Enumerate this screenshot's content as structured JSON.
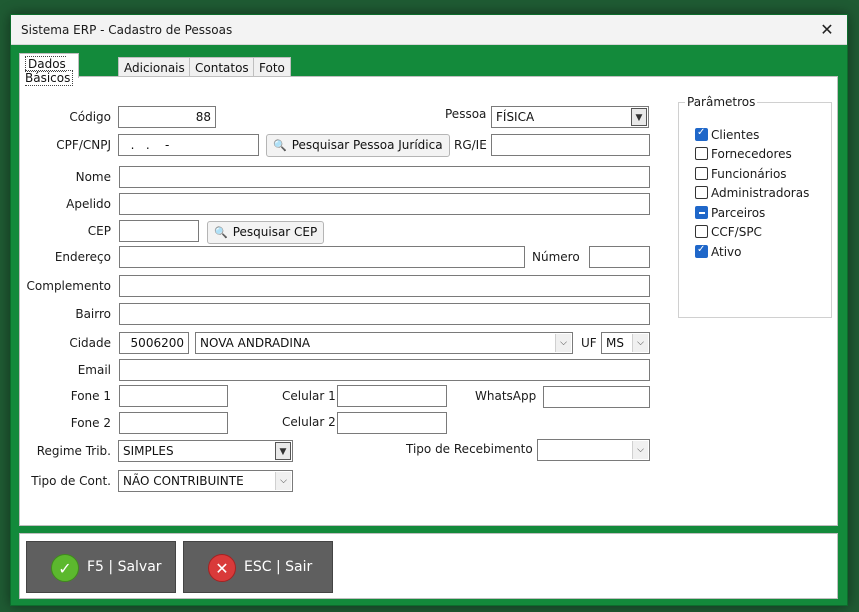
{
  "window": {
    "title": "Sistema ERP - Cadastro de Pessoas",
    "close_glyph": "✕"
  },
  "tabs": [
    {
      "label": "Dados Básicos"
    },
    {
      "label": "Adicionais"
    },
    {
      "label": "Contatos"
    },
    {
      "label": "Foto"
    }
  ],
  "form": {
    "codigo": {
      "label": "Código",
      "value": "88"
    },
    "pessoa": {
      "label": "Pessoa",
      "value": "FÍSICA"
    },
    "cpf_cnpj": {
      "label": "CPF/CNPJ",
      "value": "  .   .    -"
    },
    "btn_pesquisar_pj": "Pesquisar Pessoa Jurídica",
    "rg_ie": {
      "label": "RG/IE",
      "value": ""
    },
    "nome": {
      "label": "Nome",
      "value": ""
    },
    "apelido": {
      "label": "Apelido",
      "value": ""
    },
    "cep": {
      "label": "CEP",
      "value": ""
    },
    "btn_pesquisar_cep": "Pesquisar CEP",
    "endereco": {
      "label": "Endereço",
      "value": ""
    },
    "numero": {
      "label": "Número",
      "value": ""
    },
    "complemento": {
      "label": "Complemento",
      "value": ""
    },
    "bairro": {
      "label": "Bairro",
      "value": ""
    },
    "cidade": {
      "label": "Cidade",
      "code": "5006200",
      "name": "NOVA ANDRADINA"
    },
    "uf": {
      "label": "UF",
      "value": "MS"
    },
    "email": {
      "label": "Email",
      "value": ""
    },
    "fone1": {
      "label": "Fone 1",
      "value": ""
    },
    "celular1": {
      "label": "Celular 1",
      "value": ""
    },
    "whatsapp": {
      "label": "WhatsApp",
      "value": ""
    },
    "fone2": {
      "label": "Fone 2",
      "value": ""
    },
    "celular2": {
      "label": "Celular 2",
      "value": ""
    },
    "regime_trib": {
      "label": "Regime Trib.",
      "value": "SIMPLES"
    },
    "tipo_recebimento": {
      "label": "Tipo de Recebimento",
      "value": ""
    },
    "tipo_cont": {
      "label": "Tipo de Cont.",
      "value": "NÃO CONTRIBUINTE"
    }
  },
  "parametros": {
    "title": "Parâmetros",
    "items": [
      {
        "label": "Clientes",
        "state": "checked"
      },
      {
        "label": "Fornecedores",
        "state": "unchecked"
      },
      {
        "label": "Funcionários",
        "state": "unchecked"
      },
      {
        "label": "Administradoras",
        "state": "unchecked"
      },
      {
        "label": "Parceiros",
        "state": "indeterminate"
      },
      {
        "label": "CCF/SPC",
        "state": "unchecked"
      },
      {
        "label": "Ativo",
        "state": "checked"
      }
    ]
  },
  "footer": {
    "save_label": "F5 | Salvar",
    "exit_label": "ESC | Sair"
  },
  "icons": {
    "dropdown": "▼",
    "chevron": "⌵",
    "magnifier": "🔍",
    "check": "✓",
    "x": "✕"
  },
  "colors": {
    "accent_green": "#138a3b",
    "checkbox_blue": "#1f67c9",
    "footer_button": "#5f5f5f"
  }
}
